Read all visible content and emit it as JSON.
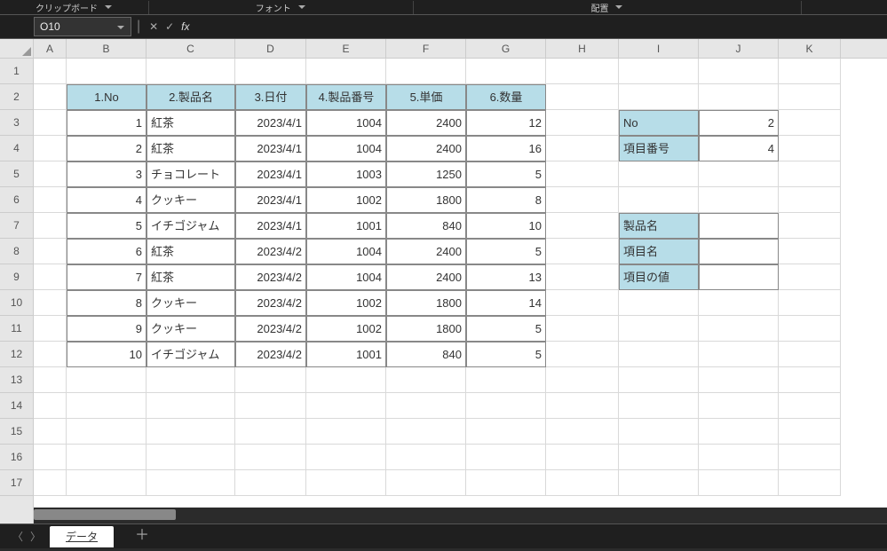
{
  "ribbon": {
    "group_clipboard": "クリップボード",
    "group_font": "フォント",
    "group_align": "配置"
  },
  "namebox": {
    "value": "O10"
  },
  "fx": {
    "cancel": "✕",
    "accept": "✓",
    "fx": "fx",
    "formula": ""
  },
  "columns": [
    "A",
    "B",
    "C",
    "D",
    "E",
    "F",
    "G",
    "H",
    "I",
    "J",
    "K"
  ],
  "rows": [
    "1",
    "2",
    "3",
    "4",
    "5",
    "6",
    "7",
    "8",
    "9",
    "10",
    "11",
    "12",
    "13",
    "14",
    "15",
    "16",
    "17"
  ],
  "headers": {
    "b": "1.No",
    "c": "2.製品名",
    "d": "3.日付",
    "e": "4.製品番号",
    "f": "5.単価",
    "g": "6.数量"
  },
  "table": [
    {
      "no": "1",
      "name": "紅茶",
      "date": "2023/4/1",
      "pid": "1004",
      "price": "2400",
      "qty": "12"
    },
    {
      "no": "2",
      "name": "紅茶",
      "date": "2023/4/1",
      "pid": "1004",
      "price": "2400",
      "qty": "16"
    },
    {
      "no": "3",
      "name": "チョコレート",
      "date": "2023/4/1",
      "pid": "1003",
      "price": "1250",
      "qty": "5"
    },
    {
      "no": "4",
      "name": "クッキー",
      "date": "2023/4/1",
      "pid": "1002",
      "price": "1800",
      "qty": "8"
    },
    {
      "no": "5",
      "name": "イチゴジャム",
      "date": "2023/4/1",
      "pid": "1001",
      "price": "840",
      "qty": "10"
    },
    {
      "no": "6",
      "name": "紅茶",
      "date": "2023/4/2",
      "pid": "1004",
      "price": "2400",
      "qty": "5"
    },
    {
      "no": "7",
      "name": "紅茶",
      "date": "2023/4/2",
      "pid": "1004",
      "price": "2400",
      "qty": "13"
    },
    {
      "no": "8",
      "name": "クッキー",
      "date": "2023/4/2",
      "pid": "1002",
      "price": "1800",
      "qty": "14"
    },
    {
      "no": "9",
      "name": "クッキー",
      "date": "2023/4/2",
      "pid": "1002",
      "price": "1800",
      "qty": "5"
    },
    {
      "no": "10",
      "name": "イチゴジャム",
      "date": "2023/4/2",
      "pid": "1001",
      "price": "840",
      "qty": "5"
    }
  ],
  "lookup1": {
    "no_label": "No",
    "no_val": "2",
    "item_label": "項目番号",
    "item_val": "4"
  },
  "lookup2": {
    "r1": "製品名",
    "r2": "項目名",
    "r3": "項目の値"
  },
  "tabs": {
    "active": "データ"
  }
}
